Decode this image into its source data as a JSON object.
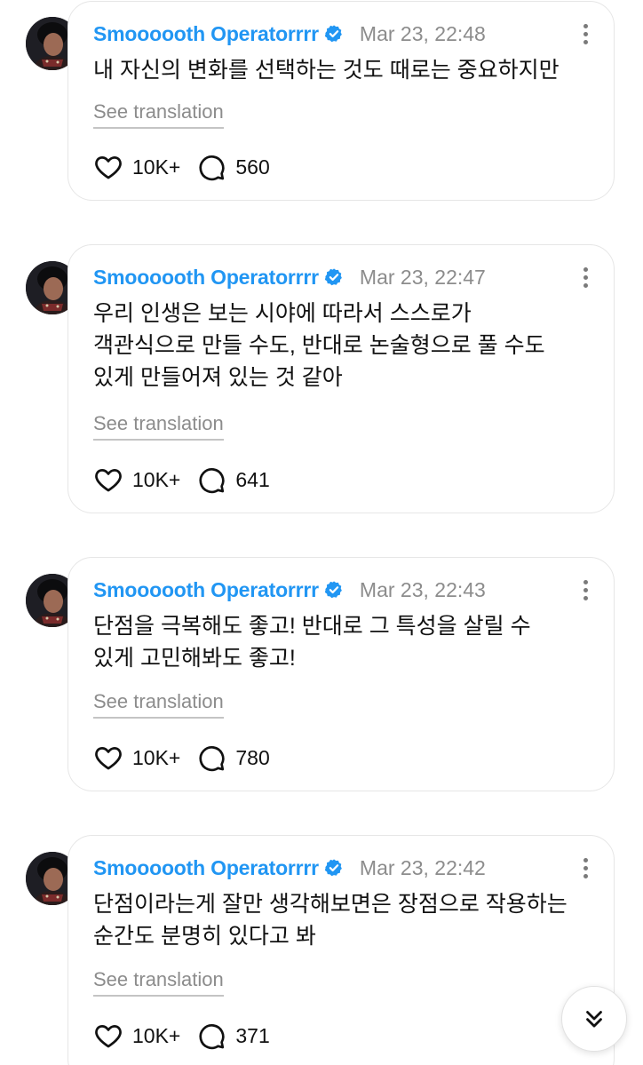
{
  "posts": [
    {
      "author": "Smoooooth Operatorrrr",
      "timestamp": "Mar 23, 22:48",
      "text": "내 자신의 변화를 선택하는 것도 때로는 중요하지만",
      "see_translation": "See translation",
      "likes": "10K+",
      "replies": "560"
    },
    {
      "author": "Smoooooth Operatorrrr",
      "timestamp": "Mar 23, 22:47",
      "text": "우리 인생은 보는 시야에 따라서 스스로가\n객관식으로 만들 수도, 반대로 논술형으로 풀 수도\n있게 만들어져 있는 것 같아",
      "see_translation": "See translation",
      "likes": "10K+",
      "replies": "641"
    },
    {
      "author": "Smoooooth Operatorrrr",
      "timestamp": "Mar 23, 22:43",
      "text": "단점을 극복해도 좋고! 반대로 그 특성을 살릴 수\n있게 고민해봐도 좋고!",
      "see_translation": "See translation",
      "likes": "10K+",
      "replies": "780"
    },
    {
      "author": "Smoooooth Operatorrrr",
      "timestamp": "Mar 23, 22:42",
      "text": "단점이라는게 잘만 생각해보면은 장점으로 작용하는\n순간도 분명히 있다고 봐",
      "see_translation": "See translation",
      "likes": "10K+",
      "replies": "371"
    }
  ],
  "icons": {
    "verified": "verified-badge-icon",
    "menu": "more-options-icon",
    "like": "heart-icon",
    "reply": "reply-bubble-icon",
    "scroll": "double-chevron-down-icon"
  },
  "colors": {
    "author": "#2196f3",
    "verified_badge": "#2196f3",
    "muted": "#8c8c8c",
    "border": "#e6e6e6"
  }
}
